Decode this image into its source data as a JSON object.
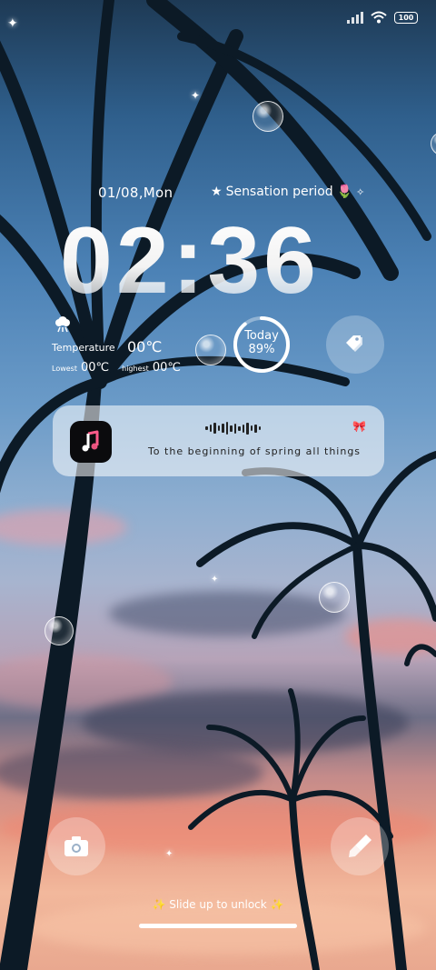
{
  "status_bar": {
    "battery": "100",
    "icons": [
      "signal-icon",
      "wifi-icon",
      "battery-icon"
    ]
  },
  "lockscreen": {
    "date": "01/08,Mon",
    "sensation": "Sensation period",
    "time": "02:36"
  },
  "weather": {
    "temperature_label": "Temperature",
    "temperature_value": "00℃",
    "lowest_label": "Lowest",
    "lowest_value": "00℃",
    "highest_label": "highest",
    "highest_value": "00℃"
  },
  "progress": {
    "label": "Today",
    "value_text": "89%",
    "value": 0.89
  },
  "music": {
    "title": "To the beginning of spring all things",
    "icon": "music-note-icon"
  },
  "shortcuts": {
    "left": "camera-icon",
    "right": "brush-icon",
    "tag": "tag-icon"
  },
  "unlock": {
    "text": "Slide up to unlock"
  }
}
